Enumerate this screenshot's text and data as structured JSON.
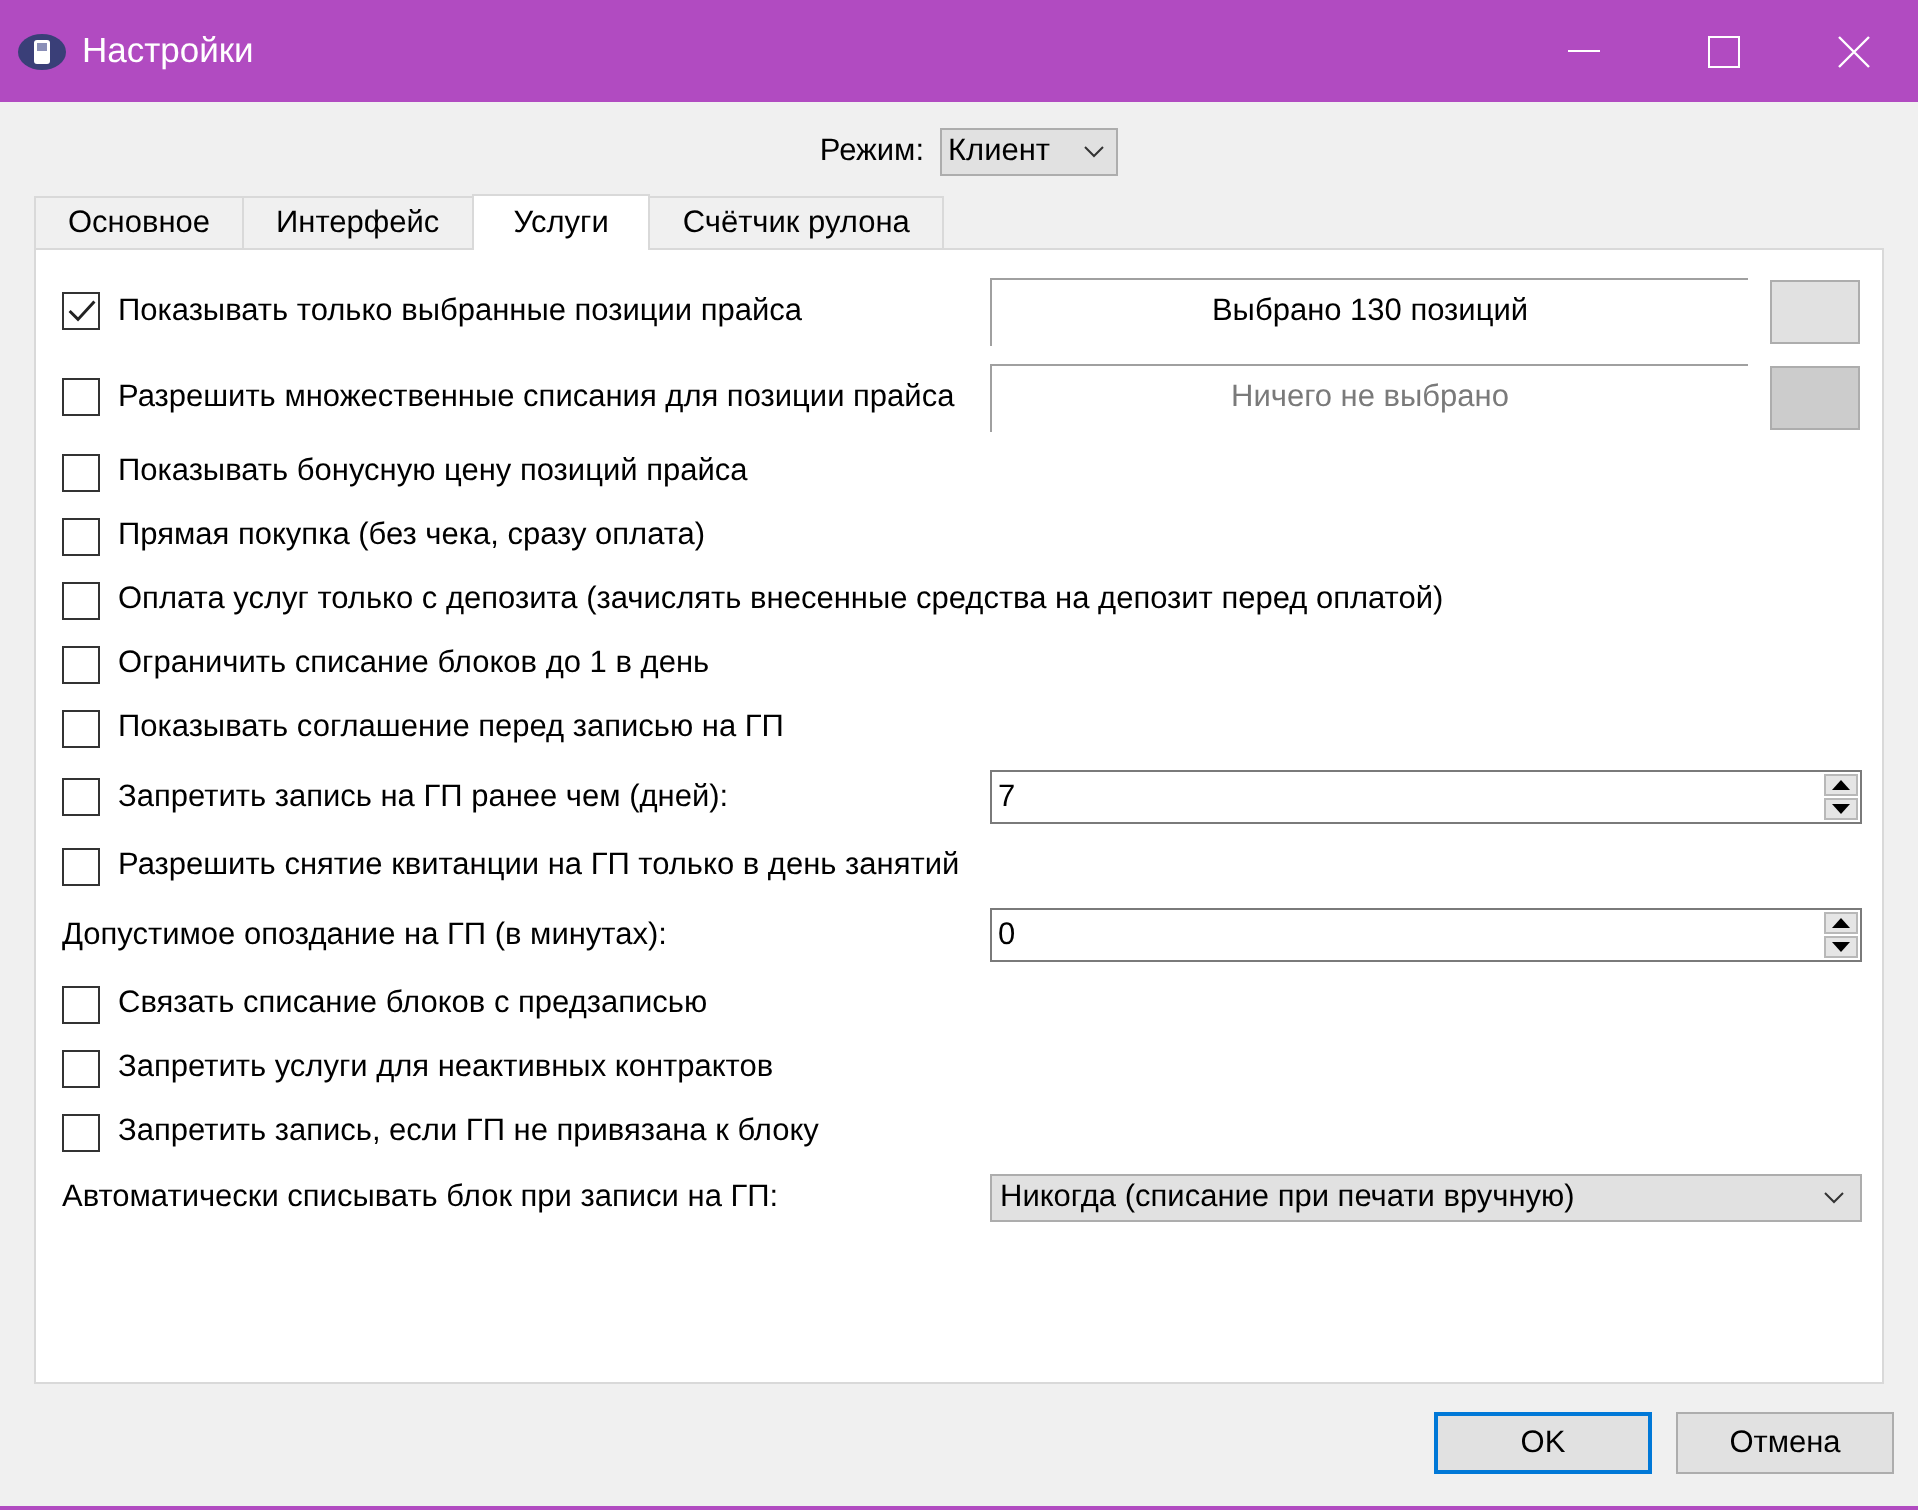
{
  "window": {
    "title": "Настройки"
  },
  "mode": {
    "label": "Режим:",
    "value": "Клиент"
  },
  "tabs": [
    {
      "label": "Основное",
      "selected": false
    },
    {
      "label": "Интерфейс",
      "selected": false
    },
    {
      "label": "Услуги",
      "selected": true
    },
    {
      "label": "Счётчик рулона",
      "selected": false
    }
  ],
  "options": [
    {
      "kind": "checkbox-picker",
      "label": "Показывать только выбранные позиции прайса",
      "checked": true,
      "picker": {
        "text": "Выбрано 130 позиций",
        "disabled": false
      }
    },
    {
      "kind": "checkbox-picker",
      "label": "Разрешить множественные списания для позиции прайса",
      "checked": false,
      "picker": {
        "text": "Ничего не выбрано",
        "disabled": true
      }
    },
    {
      "kind": "checkbox",
      "label": "Показывать бонусную цену позиций прайса",
      "checked": false
    },
    {
      "kind": "checkbox",
      "label": "Прямая покупка (без чека, сразу оплата)",
      "checked": false
    },
    {
      "kind": "checkbox",
      "label": "Оплата услуг только с депозита (зачислять внесенные средства на депозит перед оплатой)",
      "checked": false
    },
    {
      "kind": "checkbox",
      "label": "Ограничить списание блоков до 1 в день",
      "checked": false
    },
    {
      "kind": "checkbox",
      "label": "Показывать соглашение перед записью на ГП",
      "checked": false
    },
    {
      "kind": "checkbox-spin",
      "label": "Запретить запись на ГП ранее чем (дней):",
      "checked": false,
      "value": "7"
    },
    {
      "kind": "checkbox",
      "label": "Разрешить снятие квитанции на ГП только в день занятий",
      "checked": false
    },
    {
      "kind": "spin",
      "label": "Допустимое опоздание на ГП (в минутах):",
      "value": "0"
    },
    {
      "kind": "checkbox",
      "label": "Связать списание блоков с предзаписью",
      "checked": false
    },
    {
      "kind": "checkbox",
      "label": "Запретить услуги для неактивных контрактов",
      "checked": false
    },
    {
      "kind": "checkbox",
      "label": "Запретить запись, если ГП не привязана к блоку",
      "checked": false
    },
    {
      "kind": "combo",
      "label": "Автоматически списывать блок при записи на ГП:",
      "value": "Никогда (списание при печати вручную)"
    }
  ],
  "buttons": [
    {
      "label": "OK",
      "default": true
    },
    {
      "label": "Отмена",
      "default": false
    }
  ]
}
